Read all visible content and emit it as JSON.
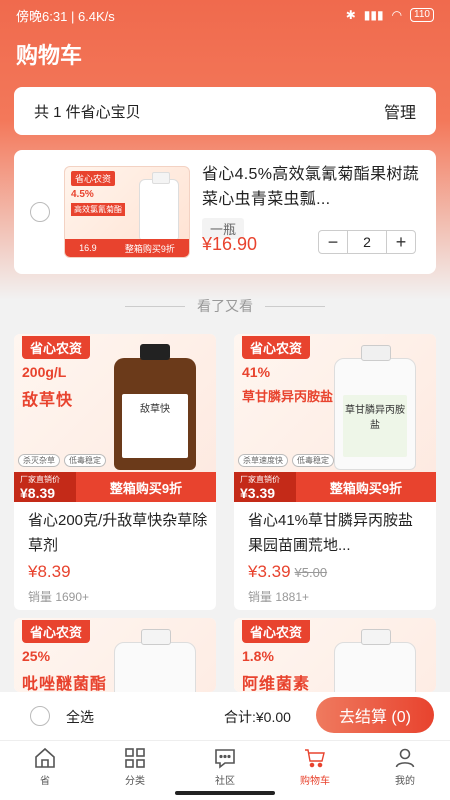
{
  "status_bar": {
    "time": "傍晚6:31",
    "speed": "6.4K/s",
    "battery": "110"
  },
  "title": "购物车",
  "summary": {
    "count_text": "共 1 件省心宝贝",
    "manage": "管理"
  },
  "cart_item": {
    "title": "省心4.5%高效氯氰菊酯果树蔬菜心虫青菜虫瓢...",
    "spec": "一瓶",
    "price": "¥16.90",
    "quantity": "2",
    "thumb": {
      "brand": "省心农资",
      "pct": "4.5%",
      "name": "高效氯氰菊酯",
      "price": "16.9",
      "deal": "整箱购买9折"
    }
  },
  "recommend_label": "看了又看",
  "products": [
    {
      "brand": "省心农资",
      "conc": "200g/L",
      "name": "敌草快",
      "bottle_label": "敌草快",
      "tags": [
        "杀灭杂草",
        "低毒稳定"
      ],
      "bar_small": "厂家直销价",
      "bar_price": "¥8.39",
      "deal": "整箱购买9折",
      "title": "省心200克/升敌草快杂草除草剂",
      "price": "¥8.39",
      "old_price": "",
      "sales": "销量 1690+"
    },
    {
      "brand": "省心农资",
      "conc": "41%",
      "name": "草甘膦异丙胺盐",
      "bottle_label": "草甘膦异丙胺盐",
      "tags": [
        "杀草速度快",
        "低毒稳定"
      ],
      "bar_small": "厂家直销价",
      "bar_price": "¥3.39",
      "deal": "整箱购买9折",
      "title": "省心41%草甘膦异丙胺盐果园苗圃荒地...",
      "price": "¥3.39",
      "old_price": "¥5.00",
      "sales": "销量 1881+"
    },
    {
      "brand": "省心农资",
      "conc": "25%",
      "name": "吡唑醚菌酯"
    },
    {
      "brand": "省心农资",
      "conc": "1.8%",
      "name": "阿维菌素"
    }
  ],
  "bottom": {
    "select_all": "全选",
    "total": "合计:¥0.00",
    "checkout": "去结算 (0)"
  },
  "tabs": [
    {
      "label": "省",
      "icon": "home-icon"
    },
    {
      "label": "分类",
      "icon": "category-icon"
    },
    {
      "label": "社区",
      "icon": "community-icon"
    },
    {
      "label": "购物车",
      "icon": "cart-icon"
    },
    {
      "label": "我的",
      "icon": "profile-icon"
    }
  ],
  "colors": {
    "accent": "#e8432e",
    "header": "#f06a4d"
  }
}
